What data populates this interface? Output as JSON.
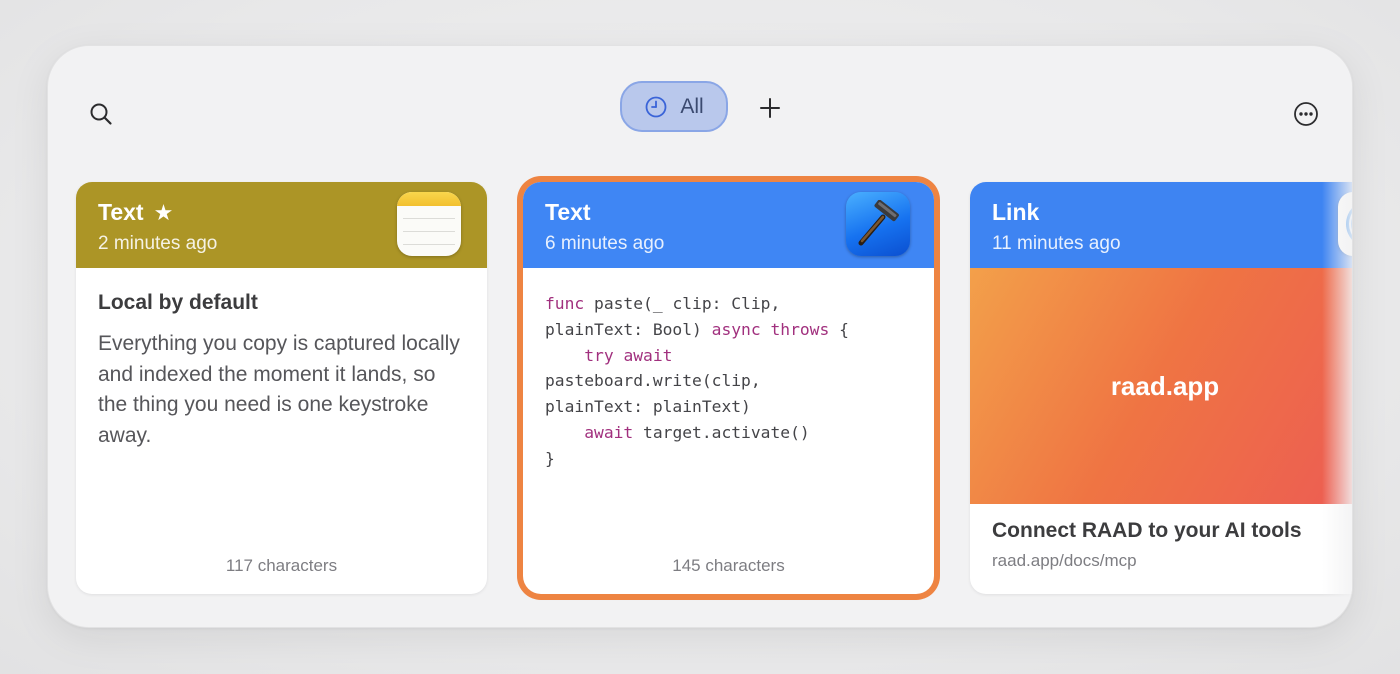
{
  "toolbar": {
    "search_icon": "search-icon",
    "filter_label": "All",
    "filter_icon": "clock-icon",
    "add_icon": "plus-icon",
    "more_icon": "ellipsis-circle-icon"
  },
  "cards": [
    {
      "type_label": "Text",
      "starred": true,
      "star": "★",
      "time": "2 minutes ago",
      "app_icon": "notes-app-icon",
      "header_color": "#ac9526",
      "heading": "Local by default",
      "body": "Everything you copy is captured locally and indexed the moment it lands, so the thing you need is one keystroke away.",
      "footer": "117 characters"
    },
    {
      "type_label": "Text",
      "time": "6 minutes ago",
      "app_icon": "xcode-app-icon",
      "header_color": "#3f86f4",
      "selected": true,
      "selection_color": "#ee8442",
      "code_lines": [
        [
          {
            "t": "func",
            "k": true
          },
          {
            "t": " paste(_ clip: Clip,"
          }
        ],
        [
          {
            "t": "plainText: Bool) "
          },
          {
            "t": "async",
            "k": true
          },
          {
            "t": " "
          },
          {
            "t": "throws",
            "k": true
          },
          {
            "t": " {"
          }
        ],
        [
          {
            "t": "    "
          },
          {
            "t": "try",
            "k": true
          },
          {
            "t": " "
          },
          {
            "t": "await",
            "k": true
          }
        ],
        [
          {
            "t": "pasteboard.write(clip,"
          }
        ],
        [
          {
            "t": "plainText: plainText)"
          }
        ],
        [
          {
            "t": "    "
          },
          {
            "t": "await",
            "k": true
          },
          {
            "t": " target.activate()"
          }
        ],
        [
          {
            "t": "}"
          }
        ]
      ],
      "footer": "145 characters"
    },
    {
      "type_label": "Link",
      "time": "11 minutes ago",
      "app_icon": "safari-app-icon",
      "header_color": "#3e84f2",
      "preview_domain": "raad.app",
      "link_title": "Connect RAAD to your AI tools",
      "link_url": "raad.app/docs/mcp"
    }
  ]
}
